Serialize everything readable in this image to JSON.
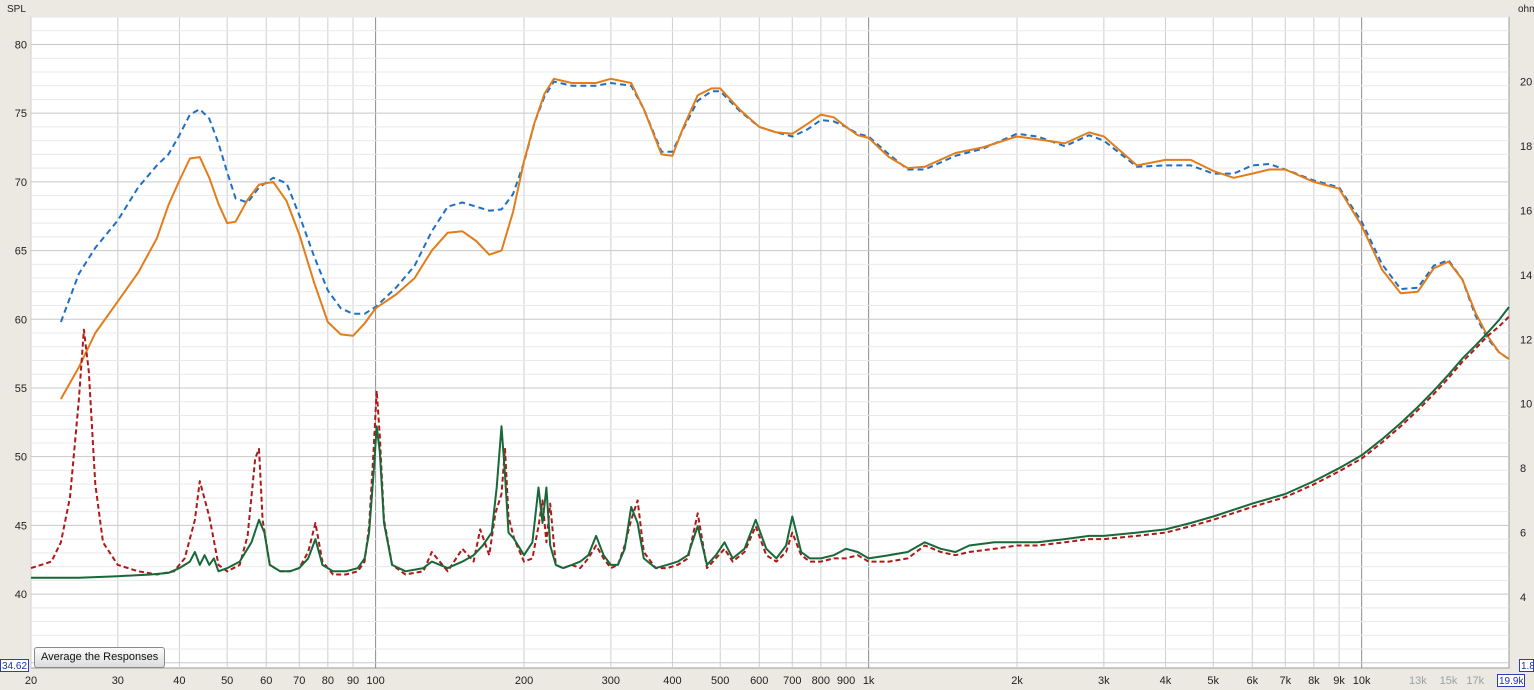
{
  "left_axis_label": "SPL",
  "right_axis_label": "ohms",
  "button_label": "Average the Responses",
  "min_spl_readout": "34.62",
  "max_freq_readout": "19.9k",
  "right_min_readout": "1.8",
  "chart_data": {
    "type": "line",
    "x_scale": "log",
    "xlim": [
      20,
      19900
    ],
    "ylim_left": [
      34.62,
      82
    ],
    "ylim_right": [
      1.8,
      22
    ],
    "grid": true,
    "x_ticks": [
      {
        "v": 20,
        "label": "20"
      },
      {
        "v": 30,
        "label": "30"
      },
      {
        "v": 40,
        "label": "40"
      },
      {
        "v": 50,
        "label": "50"
      },
      {
        "v": 60,
        "label": "60"
      },
      {
        "v": 70,
        "label": "70"
      },
      {
        "v": 80,
        "label": "80"
      },
      {
        "v": 90,
        "label": "90"
      },
      {
        "v": 100,
        "label": "100"
      },
      {
        "v": 200,
        "label": "200"
      },
      {
        "v": 300,
        "label": "300"
      },
      {
        "v": 400,
        "label": "400"
      },
      {
        "v": 500,
        "label": "500"
      },
      {
        "v": 600,
        "label": "600"
      },
      {
        "v": 700,
        "label": "700"
      },
      {
        "v": 800,
        "label": "800"
      },
      {
        "v": 900,
        "label": "900"
      },
      {
        "v": 1000,
        "label": "1k"
      },
      {
        "v": 2000,
        "label": "2k"
      },
      {
        "v": 3000,
        "label": "3k"
      },
      {
        "v": 4000,
        "label": "4k"
      },
      {
        "v": 5000,
        "label": "5k"
      },
      {
        "v": 6000,
        "label": "6k"
      },
      {
        "v": 7000,
        "label": "7k"
      },
      {
        "v": 8000,
        "label": "8k"
      },
      {
        "v": 9000,
        "label": "9k"
      },
      {
        "v": 10000,
        "label": "10k"
      },
      {
        "v": 13000,
        "label": "13k",
        "dim": true
      },
      {
        "v": 15000,
        "label": "15k",
        "dim": true
      },
      {
        "v": 17000,
        "label": "17k",
        "dim": true
      }
    ],
    "y_ticks_left": [
      40,
      45,
      50,
      55,
      60,
      65,
      70,
      75,
      80
    ],
    "y_ticks_right": [
      4,
      6,
      8,
      10,
      12,
      14,
      16,
      18,
      20
    ],
    "series": [
      {
        "axis": "left",
        "color": "#1f6fc4",
        "dash": "6,4",
        "x": [
          23,
          25,
          27,
          30,
          33,
          36,
          38,
          40,
          42,
          44,
          46,
          48,
          50,
          52,
          55,
          58,
          62,
          66,
          70,
          75,
          80,
          85,
          90,
          95,
          100,
          110,
          120,
          130,
          140,
          150,
          160,
          170,
          180,
          190,
          200,
          210,
          220,
          230,
          250,
          280,
          300,
          330,
          350,
          380,
          400,
          420,
          450,
          480,
          500,
          550,
          600,
          650,
          700,
          750,
          800,
          850,
          900,
          950,
          1000,
          1100,
          1200,
          1300,
          1500,
          1700,
          2000,
          2200,
          2500,
          2800,
          3000,
          3500,
          4000,
          4500,
          5000,
          5500,
          6000,
          6500,
          7000,
          8000,
          9000,
          10000,
          11000,
          12000,
          13000,
          14000,
          15000,
          16000,
          17000,
          18000,
          19000,
          19900
        ],
        "y": [
          59.8,
          63.3,
          65.2,
          67.2,
          69.6,
          71.2,
          72.0,
          73.4,
          74.9,
          75.3,
          74.6,
          72.8,
          70.7,
          68.8,
          68.5,
          69.6,
          70.3,
          69.9,
          67.6,
          64.6,
          62.1,
          60.8,
          60.4,
          60.4,
          60.9,
          62.3,
          63.9,
          66.4,
          68.2,
          68.5,
          68.2,
          67.9,
          68.0,
          69.1,
          71.4,
          74.3,
          76.2,
          77.3,
          77.0,
          77.0,
          77.2,
          77.0,
          75.3,
          72.2,
          72.2,
          73.8,
          75.9,
          76.6,
          76.6,
          75.1,
          74.0,
          73.6,
          73.3,
          73.8,
          74.5,
          74.4,
          74.0,
          73.5,
          73.3,
          72.0,
          70.9,
          70.9,
          71.9,
          72.4,
          73.5,
          73.3,
          72.6,
          73.4,
          73.0,
          71.1,
          71.2,
          71.2,
          70.6,
          70.6,
          71.2,
          71.3,
          70.9,
          70.1,
          69.6,
          67.1,
          64.0,
          62.2,
          62.3,
          63.9,
          64.3,
          62.9,
          60.3,
          58.6,
          57.6,
          57.1
        ]
      },
      {
        "axis": "left",
        "color": "#e27d1a",
        "dash": "",
        "x": [
          23,
          25,
          27,
          30,
          33,
          36,
          38,
          40,
          42,
          44,
          46,
          48,
          50,
          52,
          55,
          58,
          62,
          66,
          70,
          75,
          80,
          85,
          90,
          95,
          100,
          110,
          120,
          130,
          140,
          150,
          160,
          170,
          180,
          190,
          200,
          210,
          220,
          230,
          250,
          280,
          300,
          330,
          350,
          380,
          400,
          420,
          450,
          480,
          500,
          550,
          600,
          650,
          700,
          750,
          800,
          850,
          900,
          950,
          1000,
          1100,
          1200,
          1300,
          1500,
          1700,
          2000,
          2200,
          2500,
          2800,
          3000,
          3500,
          4000,
          4500,
          5000,
          5500,
          6000,
          6500,
          7000,
          8000,
          9000,
          10000,
          11000,
          12000,
          13000,
          14000,
          15000,
          16000,
          17000,
          18000,
          19000,
          19900
        ],
        "y": [
          54.2,
          56.5,
          59.0,
          61.3,
          63.4,
          65.9,
          68.3,
          70.1,
          71.7,
          71.8,
          70.3,
          68.4,
          67.0,
          67.1,
          68.7,
          69.8,
          70.0,
          68.6,
          66.2,
          62.7,
          59.8,
          58.9,
          58.8,
          59.7,
          60.8,
          61.8,
          63.0,
          65.0,
          66.3,
          66.4,
          65.7,
          64.7,
          65.0,
          67.8,
          71.5,
          74.3,
          76.4,
          77.5,
          77.2,
          77.2,
          77.5,
          77.2,
          75.3,
          72.0,
          71.9,
          73.9,
          76.3,
          76.8,
          76.8,
          75.2,
          74.0,
          73.6,
          73.5,
          74.2,
          74.9,
          74.7,
          74.0,
          73.4,
          73.2,
          71.8,
          71.0,
          71.1,
          72.1,
          72.5,
          73.3,
          73.1,
          72.8,
          73.6,
          73.3,
          71.2,
          71.6,
          71.6,
          70.8,
          70.3,
          70.6,
          70.9,
          70.9,
          70.0,
          69.5,
          66.8,
          63.6,
          61.9,
          62.0,
          63.7,
          64.2,
          62.9,
          60.5,
          58.8,
          57.6,
          57.1
        ]
      },
      {
        "axis": "right",
        "color": "#b01818",
        "dash": "5,3",
        "x": [
          20,
          22,
          23,
          24,
          25,
          25.6,
          26.2,
          27,
          28,
          30,
          33,
          36,
          39,
          41,
          43,
          44,
          46,
          48,
          50,
          53,
          55,
          57,
          58,
          59,
          61,
          64,
          67,
          70,
          73,
          75.5,
          78,
          82,
          87,
          92,
          95,
          97,
          99,
          100.5,
          102,
          104,
          108,
          115,
          125,
          130,
          140,
          150,
          158,
          163,
          170,
          175,
          180,
          183,
          186,
          191,
          200,
          208,
          214,
          218,
          222,
          226,
          232,
          240,
          250,
          260,
          270,
          280,
          290,
          300,
          310,
          320,
          330,
          340,
          350,
          370,
          390,
          410,
          430,
          450,
          470,
          490,
          510,
          530,
          560,
          590,
          620,
          650,
          680,
          700,
          730,
          760,
          800,
          850,
          900,
          950,
          1000,
          1100,
          1200,
          1300,
          1400,
          1500,
          1600,
          1800,
          2000,
          2200,
          2500,
          2800,
          3000,
          3500,
          4000,
          4500,
          5000,
          6000,
          7000,
          8000,
          9000,
          10000,
          11000,
          12000,
          13000,
          14000,
          15000,
          16000,
          17000,
          18000,
          19000,
          19900
        ],
        "y": [
          4.9,
          5.1,
          5.7,
          7.1,
          10.1,
          12.3,
          11.0,
          7.5,
          5.7,
          5.0,
          4.8,
          4.7,
          4.8,
          5.2,
          6.4,
          7.6,
          6.5,
          5.0,
          4.8,
          5.0,
          5.9,
          8.3,
          8.6,
          6.4,
          5.0,
          4.8,
          4.8,
          4.9,
          5.4,
          6.3,
          5.1,
          4.7,
          4.7,
          4.8,
          5.1,
          6.2,
          8.5,
          10.4,
          9.0,
          6.4,
          5.0,
          4.7,
          4.8,
          5.4,
          4.8,
          5.5,
          5.1,
          6.1,
          5.3,
          6.6,
          7.2,
          8.6,
          6.5,
          5.8,
          5.1,
          5.2,
          6.2,
          7.0,
          5.7,
          6.9,
          5.0,
          4.9,
          5.0,
          4.9,
          5.2,
          5.6,
          5.2,
          4.9,
          5.0,
          5.6,
          6.4,
          7.0,
          5.4,
          4.9,
          4.9,
          5.0,
          5.2,
          6.6,
          4.9,
          5.2,
          5.5,
          5.1,
          5.4,
          6.2,
          5.3,
          5.1,
          5.4,
          6.0,
          5.3,
          5.1,
          5.1,
          5.2,
          5.2,
          5.3,
          5.1,
          5.1,
          5.2,
          5.6,
          5.4,
          5.3,
          5.4,
          5.5,
          5.6,
          5.6,
          5.7,
          5.8,
          5.8,
          5.9,
          6.0,
          6.2,
          6.4,
          6.8,
          7.1,
          7.5,
          7.9,
          8.3,
          8.8,
          9.3,
          9.8,
          10.3,
          10.8,
          11.3,
          11.7,
          12.1,
          12.4,
          12.7
        ]
      },
      {
        "axis": "right",
        "color": "#17693a",
        "dash": "",
        "x": [
          20,
          25,
          30,
          35,
          38,
          40,
          42,
          43,
          44,
          45,
          46,
          47,
          48,
          50,
          53,
          56,
          58,
          59.5,
          61,
          64,
          67,
          70,
          73,
          75.5,
          78,
          82,
          87,
          92,
          95,
          97,
          99,
          100.5,
          102,
          104,
          108,
          115,
          125,
          130,
          140,
          150,
          158,
          165,
          172,
          176,
          180,
          183,
          186,
          191,
          200,
          208,
          214,
          218,
          222,
          226,
          232,
          240,
          250,
          260,
          270,
          280,
          290,
          300,
          310,
          320,
          330,
          340,
          350,
          370,
          390,
          410,
          430,
          450,
          470,
          490,
          510,
          530,
          560,
          590,
          620,
          650,
          680,
          700,
          730,
          760,
          800,
          850,
          900,
          950,
          1000,
          1100,
          1200,
          1300,
          1400,
          1500,
          1600,
          1800,
          2000,
          2200,
          2500,
          2800,
          3000,
          3500,
          4000,
          4500,
          5000,
          6000,
          7000,
          8000,
          9000,
          10000,
          11000,
          12000,
          13000,
          14000,
          15000,
          16000,
          17000,
          18000,
          19000,
          19900
        ],
        "y": [
          4.6,
          4.6,
          4.65,
          4.7,
          4.75,
          4.9,
          5.1,
          5.4,
          5.0,
          5.3,
          5.0,
          5.2,
          4.8,
          4.9,
          5.1,
          5.7,
          6.4,
          6.0,
          5.0,
          4.8,
          4.8,
          4.9,
          5.2,
          5.8,
          5.0,
          4.8,
          4.8,
          4.9,
          5.2,
          6.0,
          7.8,
          9.3,
          8.5,
          6.3,
          5.0,
          4.8,
          4.9,
          5.1,
          4.9,
          5.1,
          5.3,
          5.6,
          6.0,
          7.4,
          9.3,
          7.8,
          6.0,
          5.8,
          5.3,
          5.7,
          7.4,
          6.3,
          7.4,
          5.6,
          5.0,
          4.9,
          5.0,
          5.1,
          5.3,
          5.9,
          5.3,
          5.0,
          5.0,
          5.5,
          6.8,
          6.3,
          5.2,
          4.9,
          5.0,
          5.1,
          5.3,
          6.2,
          5.0,
          5.3,
          5.7,
          5.2,
          5.5,
          6.4,
          5.5,
          5.2,
          5.6,
          6.5,
          5.4,
          5.2,
          5.2,
          5.3,
          5.5,
          5.4,
          5.2,
          5.3,
          5.4,
          5.7,
          5.5,
          5.4,
          5.6,
          5.7,
          5.7,
          5.7,
          5.8,
          5.9,
          5.9,
          6.0,
          6.1,
          6.3,
          6.5,
          6.9,
          7.2,
          7.6,
          8.0,
          8.4,
          8.9,
          9.4,
          9.9,
          10.4,
          10.9,
          11.4,
          11.8,
          12.2,
          12.6,
          13.0
        ]
      }
    ]
  }
}
